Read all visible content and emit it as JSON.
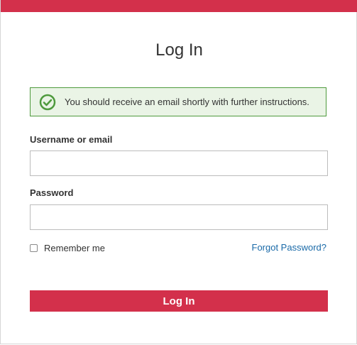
{
  "page": {
    "title": "Log In",
    "accent_color": "#d3304b"
  },
  "alert": {
    "type": "success",
    "icon": "check-circle-icon",
    "color": "#4e9a3d",
    "message": "You should receive an email shortly with further instructions."
  },
  "form": {
    "username": {
      "label": "Username or email",
      "value": "",
      "placeholder": ""
    },
    "password": {
      "label": "Password",
      "value": "",
      "placeholder": ""
    },
    "remember_me": {
      "label": "Remember me",
      "checked": false
    },
    "forgot_password_label": "Forgot Password?",
    "submit_label": "Log In"
  }
}
